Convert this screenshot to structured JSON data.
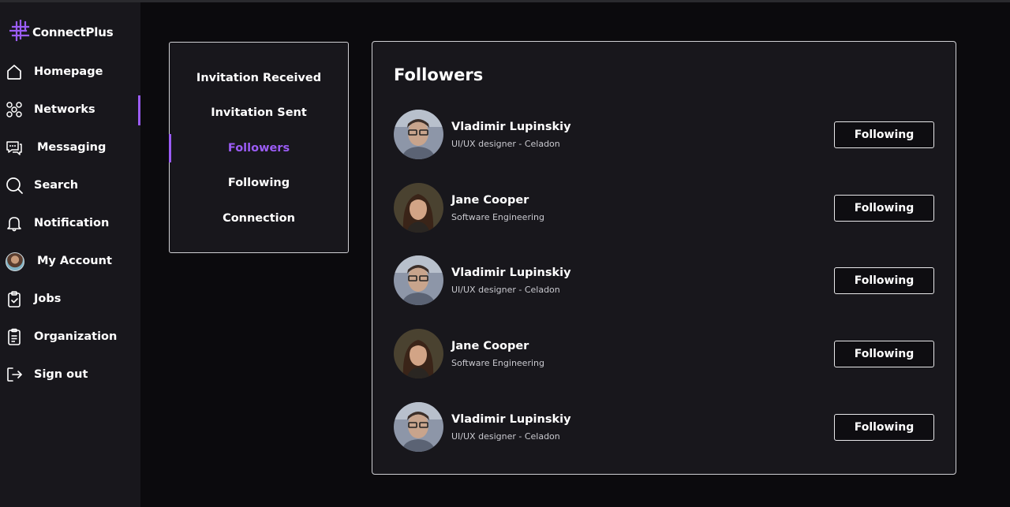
{
  "app": {
    "name": "ConnectPlus",
    "accent": "#9b5cf5"
  },
  "sidebar": {
    "items": [
      {
        "label": "Homepage",
        "icon": "home-icon"
      },
      {
        "label": "Networks",
        "icon": "network-icon",
        "active": true
      },
      {
        "label": "Messaging",
        "icon": "chat-icon"
      },
      {
        "label": "Search",
        "icon": "search-icon"
      },
      {
        "label": "Notification",
        "icon": "bell-icon"
      },
      {
        "label": "My Account",
        "icon": "avatar"
      },
      {
        "label": "Jobs",
        "icon": "clipboard-check-icon"
      },
      {
        "label": "Organization",
        "icon": "document-icon"
      },
      {
        "label": "Sign out",
        "icon": "sign-out-icon"
      }
    ]
  },
  "submenu": {
    "items": [
      {
        "label": "Invitation Received"
      },
      {
        "label": "Invitation Sent"
      },
      {
        "label": "Followers",
        "active": true
      },
      {
        "label": "Following"
      },
      {
        "label": "Connection"
      }
    ]
  },
  "main": {
    "title": "Followers",
    "rows": [
      {
        "name": "Vladimir Lupinskiy",
        "role": "UI/UX designer - Celadon",
        "button": "Following"
      },
      {
        "name": "Jane Cooper",
        "role": "Software Engineering",
        "button": "Following"
      },
      {
        "name": "Vladimir Lupinskiy",
        "role": "UI/UX designer - Celadon",
        "button": "Following"
      },
      {
        "name": "Jane Cooper",
        "role": "Software Engineering",
        "button": "Following"
      },
      {
        "name": "Vladimir Lupinskiy",
        "role": "UI/UX designer - Celadon",
        "button": "Following"
      }
    ]
  }
}
